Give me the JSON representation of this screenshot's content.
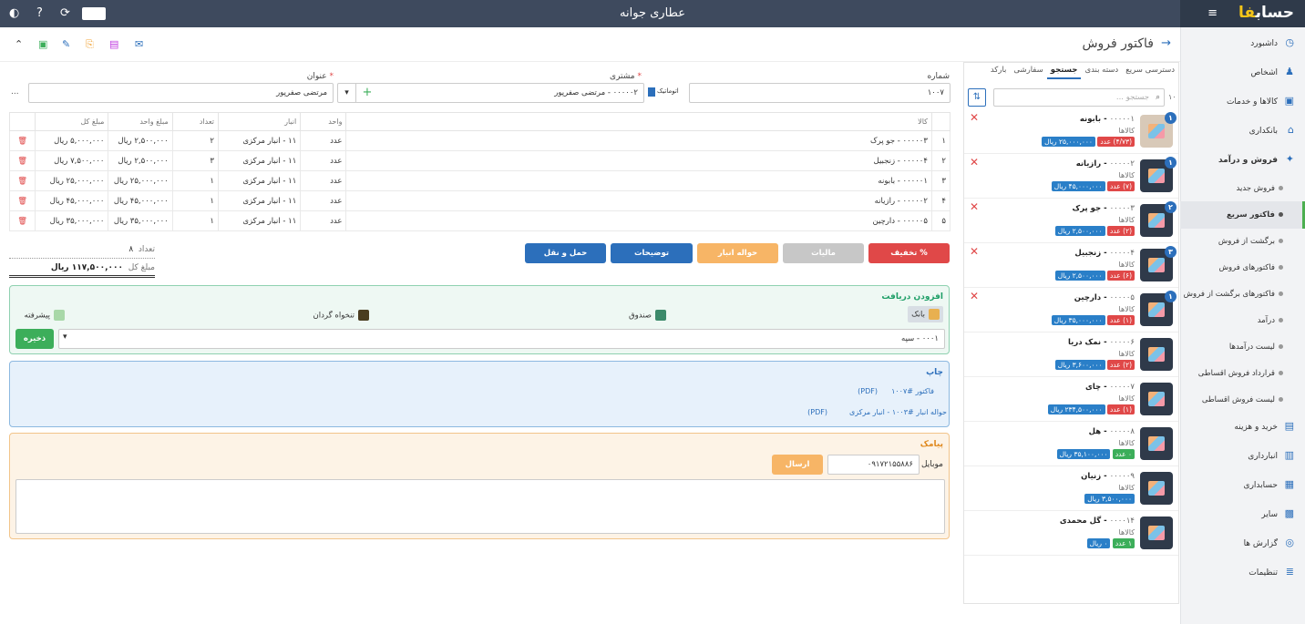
{
  "topbar": {
    "title": "عطاری جوانه",
    "logo_main": "حساب",
    "logo_accent": "فا"
  },
  "sidebar": {
    "items": [
      {
        "label": "داشبورد",
        "icon": "dashboard-icon",
        "type": "main"
      },
      {
        "label": "اشخاص",
        "icon": "people-icon",
        "type": "main"
      },
      {
        "label": "کالاها و خدمات",
        "icon": "box-icon",
        "type": "main"
      },
      {
        "label": "بانکداری",
        "icon": "bank-icon",
        "type": "main"
      },
      {
        "label": "فروش و درآمد",
        "icon": "sales-icon",
        "type": "main-open"
      },
      {
        "label": "فروش جدید",
        "type": "sub"
      },
      {
        "label": "فاکتور سریع",
        "type": "sub-active"
      },
      {
        "label": "برگشت از فروش",
        "type": "sub"
      },
      {
        "label": "فاکتورهای فروش",
        "type": "sub"
      },
      {
        "label": "فاکتورهای برگشت از فروش",
        "type": "sub"
      },
      {
        "label": "درآمد",
        "type": "sub"
      },
      {
        "label": "لیست درآمدها",
        "type": "sub"
      },
      {
        "label": "قرارداد فروش اقساطی",
        "type": "sub"
      },
      {
        "label": "لیست فروش اقساطی",
        "type": "sub"
      },
      {
        "label": "خرید و هزینه",
        "icon": "cart-icon",
        "type": "main"
      },
      {
        "label": "انبارداری",
        "icon": "warehouse-icon",
        "type": "main"
      },
      {
        "label": "حسابداری",
        "icon": "ledger-icon",
        "type": "main"
      },
      {
        "label": "سایر",
        "icon": "apps-icon",
        "type": "main"
      },
      {
        "label": "گزارش ها",
        "icon": "report-icon",
        "type": "main"
      },
      {
        "label": "تنظیمات",
        "icon": "settings-icon",
        "type": "main"
      }
    ]
  },
  "page": {
    "title": "فاکتور فروش"
  },
  "form": {
    "number_label": "شماره",
    "number_value": "۱۰۰۷",
    "auto_label": "اتوماتیک",
    "customer_label": "مشتری",
    "customer_value": "۰۰۰۰۰۲ - مرتضی صفرپور",
    "subject_label": "عنوان",
    "subject_value": "مرتضی صفرپور",
    "more": "..."
  },
  "table": {
    "headers": [
      "",
      "کالا",
      "واحد",
      "انبار",
      "تعداد",
      "مبلغ واحد",
      "مبلغ کل",
      ""
    ],
    "rows": [
      [
        "۱",
        "۰۰۰۰۰۳ - جو پرک",
        "عدد",
        "۱۱ - انبار مرکزی",
        "۲",
        "۲,۵۰۰,۰۰۰ ریال",
        "۵,۰۰۰,۰۰۰ ریال"
      ],
      [
        "۲",
        "۰۰۰۰۰۴ - زنجبیل",
        "عدد",
        "۱۱ - انبار مرکزی",
        "۳",
        "۲,۵۰۰,۰۰۰ ریال",
        "۷,۵۰۰,۰۰۰ ریال"
      ],
      [
        "۳",
        "۰۰۰۰۰۱ - بابونه",
        "عدد",
        "۱۱ - انبار مرکزی",
        "۱",
        "۲۵,۰۰۰,۰۰۰ ریال",
        "۲۵,۰۰۰,۰۰۰ ریال"
      ],
      [
        "۴",
        "۰۰۰۰۰۲ - رازیانه",
        "عدد",
        "۱۱ - انبار مرکزی",
        "۱",
        "۴۵,۰۰۰,۰۰۰ ریال",
        "۴۵,۰۰۰,۰۰۰ ریال"
      ],
      [
        "۵",
        "۰۰۰۰۰۵ - دارچین",
        "عدد",
        "۱۱ - انبار مرکزی",
        "۱",
        "۳۵,۰۰۰,۰۰۰ ریال",
        "۳۵,۰۰۰,۰۰۰ ریال"
      ]
    ]
  },
  "totals": {
    "count_label": "تعداد",
    "count_value": "۸",
    "sum_label": "مبلغ کل",
    "sum_value": "۱۱۷,۵۰۰,۰۰۰ ریال"
  },
  "actions": {
    "discount": "تخفیف",
    "tax": "مالیات",
    "warehouse": "حواله انبار",
    "notes": "توضیحات",
    "shipping": "حمل و نقل"
  },
  "payment": {
    "title": "افزودن دریافت",
    "bank": "بانک",
    "cash": "صندوق",
    "petty": "تنخواه گردان",
    "advanced": "پیشرفته",
    "account_value": "۰۰۰۱ - سپه",
    "save": "ذخیره"
  },
  "print": {
    "title": "چاپ",
    "invoice": "فاکتور #۱۰۰۷",
    "invoice_pdf": "(PDF)",
    "transfer": "حواله انبار #۱۰۰۳ - انبار مرکزی",
    "transfer_pdf": "(PDF)"
  },
  "sms": {
    "title": "پیامک",
    "mobile_label": "موبایل",
    "mobile_value": "۰۹۱۷۲۱۵۵۸۸۶",
    "send": "ارسال"
  },
  "rpanel": {
    "tabs": [
      "دسترسی سریع",
      "دسته بندی",
      "جستجو",
      "سفارشی",
      "بارکد"
    ],
    "search_placeholder": "جستجو ...",
    "result_count": "۱۰",
    "products": [
      {
        "code": "۰۰۰۰۰۱",
        "name": "بابونه",
        "cat": "کالاها",
        "count": "۱",
        "qty": "(۴/۷۳)",
        "unit": "عدد",
        "price": "۲۵,۰۰۰,۰۰۰ ریال",
        "qty_color": "red",
        "photo": true
      },
      {
        "code": "۰۰۰۰۰۲",
        "name": "رازیانه",
        "cat": "کالاها",
        "count": "۱",
        "qty": "(۷)",
        "unit": "عدد",
        "price": "۴۵,۰۰۰,۰۰۰ ریال",
        "qty_color": "red",
        "photo": false
      },
      {
        "code": "۰۰۰۰۰۳",
        "name": "جو پرک",
        "cat": "کالاها",
        "count": "۲",
        "qty": "(۲)",
        "unit": "عدد",
        "price": "۲,۵۰۰,۰۰۰ ریال",
        "qty_color": "red",
        "photo": false
      },
      {
        "code": "۰۰۰۰۰۴",
        "name": "زنجبیل",
        "cat": "کالاها",
        "count": "۳",
        "qty": "(۶)",
        "unit": "عدد",
        "price": "۲,۵۰۰,۰۰۰ ریال",
        "qty_color": "red",
        "photo": false
      },
      {
        "code": "۰۰۰۰۰۵",
        "name": "دارچین",
        "cat": "کالاها",
        "count": "۱",
        "qty": "(۱)",
        "unit": "عدد",
        "price": "۳۵,۰۰۰,۰۰۰ ریال",
        "qty_color": "red",
        "photo": false
      },
      {
        "code": "۰۰۰۰۰۶",
        "name": "نمک دریا",
        "cat": "کالاها",
        "count": "",
        "qty": "(۲)",
        "unit": "عدد",
        "price": "۳,۶۰۰,۰۰۰ ریال",
        "qty_color": "red",
        "photo": false
      },
      {
        "code": "۰۰۰۰۰۷",
        "name": "چای",
        "cat": "کالاها",
        "count": "",
        "qty": "(۱)",
        "unit": "عدد",
        "price": "۲۳۴,۵۰۰,۰۰۰ ریال",
        "qty_color": "red",
        "photo": false
      },
      {
        "code": "۰۰۰۰۰۸",
        "name": "هل",
        "cat": "کالاها",
        "count": "",
        "qty": "۰",
        "unit": "عدد",
        "price": "۳۵,۱۰۰,۰۰۰ ریال",
        "qty_color": "green",
        "photo": false
      },
      {
        "code": "۰۰۰۰۰۹",
        "name": "زنیان",
        "cat": "کالاها",
        "count": "",
        "qty": "",
        "unit": "",
        "price": "۳,۵۰۰,۰۰۰ ریال",
        "qty_color": "none",
        "photo": false
      },
      {
        "code": "۰۰۰۰۱۴",
        "name": "گل محمدی",
        "cat": "کالاها",
        "count": "",
        "qty": "۱",
        "unit": "عدد",
        "price": "۰ ریال",
        "qty_color": "green",
        "photo": false
      }
    ]
  },
  "colors": {
    "topbar": "#3e4a5e",
    "accent": "#2c6fbb",
    "active": "#4caf50",
    "danger": "#e04848"
  }
}
